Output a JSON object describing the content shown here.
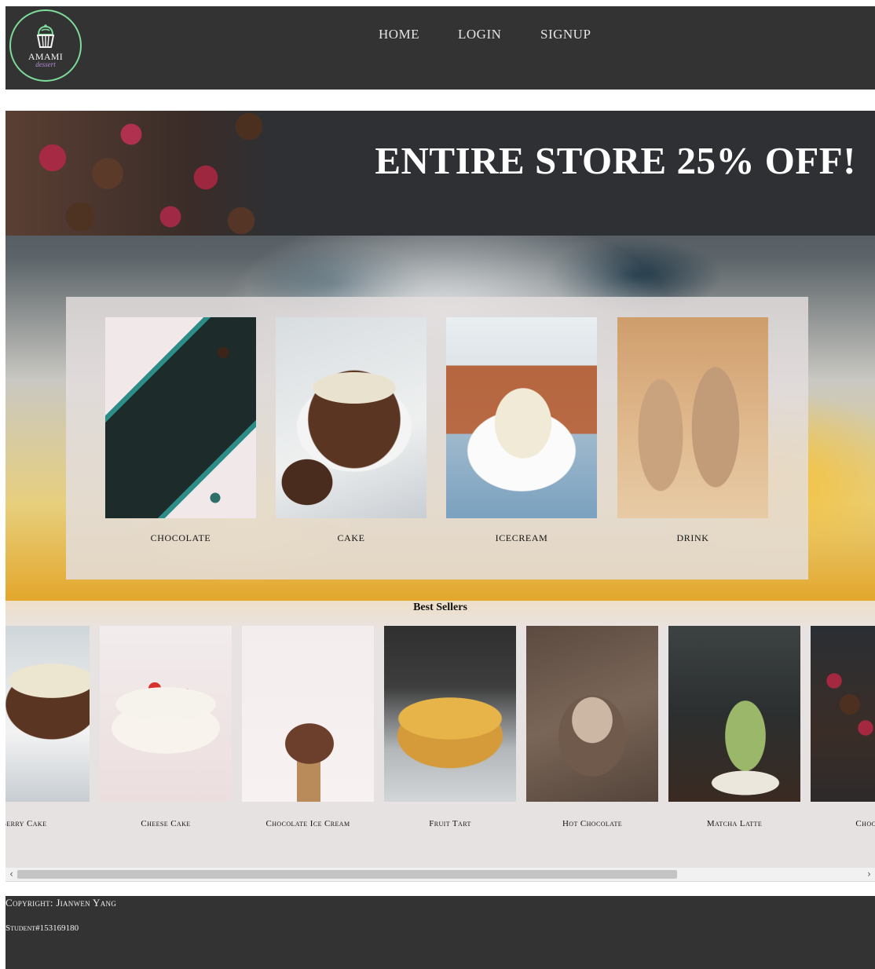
{
  "header": {
    "logo": {
      "name": "AMAMI",
      "subtitle": "dessert"
    },
    "nav": [
      {
        "label": "HOME"
      },
      {
        "label": "LOGIN"
      },
      {
        "label": "SIGNUP"
      }
    ]
  },
  "hero": {
    "promo": "ENTIRE STORE 25% OFF!",
    "categories": [
      {
        "label": "CHOCOLATE"
      },
      {
        "label": "CAKE"
      },
      {
        "label": "ICECREAM"
      },
      {
        "label": "DRINK"
      }
    ]
  },
  "best_sellers": {
    "title": "Best Sellers",
    "products": [
      {
        "label": "Berry Cake"
      },
      {
        "label": "Cheese Cake"
      },
      {
        "label": "Chocolate Ice Cream"
      },
      {
        "label": "Fruit Tart"
      },
      {
        "label": "Hot Chocolate"
      },
      {
        "label": "Matcha Latte"
      },
      {
        "label": "Chocolate"
      }
    ],
    "scroll_position": 0.0,
    "scroll_visible_fraction": 0.78
  },
  "footer": {
    "copyright": "Copyright: Jianwen Yang",
    "student": "Student#153169180"
  },
  "colors": {
    "header_bg": "#333333",
    "logo_ring": "#7ddc9a",
    "logo_subtitle": "#b28bd6",
    "panel_bg": "#e4dede",
    "footer_bg": "#333333"
  },
  "icons": {
    "logo": "cupcake-icon",
    "scroll_left": "chevron-left-icon",
    "scroll_right": "chevron-right-icon"
  }
}
